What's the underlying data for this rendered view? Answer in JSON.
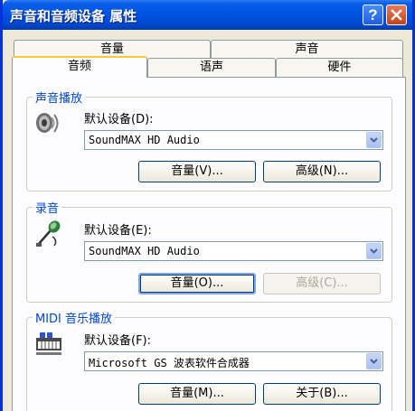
{
  "window": {
    "title": "声音和音频设备 属性",
    "help_button": "?",
    "close_button": "✕"
  },
  "tabs": {
    "row_back": [
      "音量",
      "声音"
    ],
    "row_front": [
      "音频",
      "语声",
      "硬件"
    ],
    "active": "音频"
  },
  "playback": {
    "title": "声音播放",
    "device_label": "默认设备(D):",
    "device_value": "SoundMAX HD Audio",
    "volume_button": "音量(V)...",
    "advanced_button": "高级(N)..."
  },
  "recording": {
    "title": "录音",
    "device_label": "默认设备(E):",
    "device_value": "SoundMAX HD Audio",
    "volume_button": "音量(O)...",
    "advanced_button": "高级(C)..."
  },
  "midi": {
    "title": "MIDI 音乐播放",
    "device_label": "默认设备(F):",
    "device_value": "Microsoft GS 波表软件合成器",
    "volume_button": "音量(M)...",
    "about_button": "关于(B)..."
  }
}
